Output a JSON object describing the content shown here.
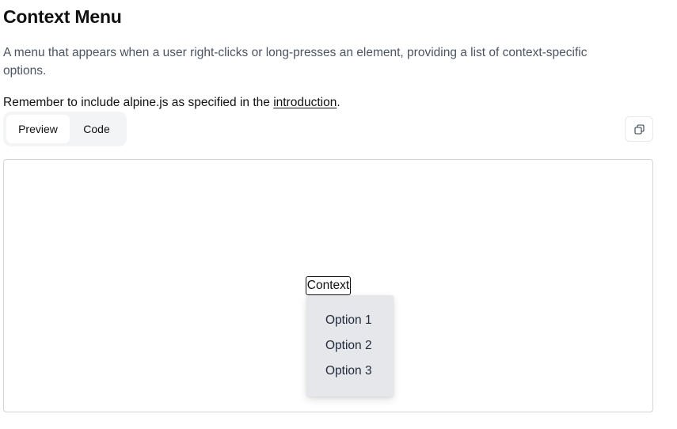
{
  "header": {
    "title": "Context Menu",
    "description": "A menu that appears when a user right-clicks or long-presses an element, providing a list of context-specific options.",
    "remember_prefix": "Remember to include alpine.js as specified in the ",
    "remember_link": "introduction",
    "remember_suffix": "."
  },
  "tabs": [
    {
      "label": "Preview",
      "active": true
    },
    {
      "label": "Code",
      "active": false
    }
  ],
  "toolbar": {
    "copy_icon": "copy-icon"
  },
  "preview": {
    "trigger_label": "Context",
    "menu_items": [
      "Option 1",
      "Option 2",
      "Option 3"
    ]
  },
  "colors": {
    "menu_background": "#e5e7eb",
    "tabs_background": "#f3f4f6",
    "description_text": "#4b5563"
  }
}
